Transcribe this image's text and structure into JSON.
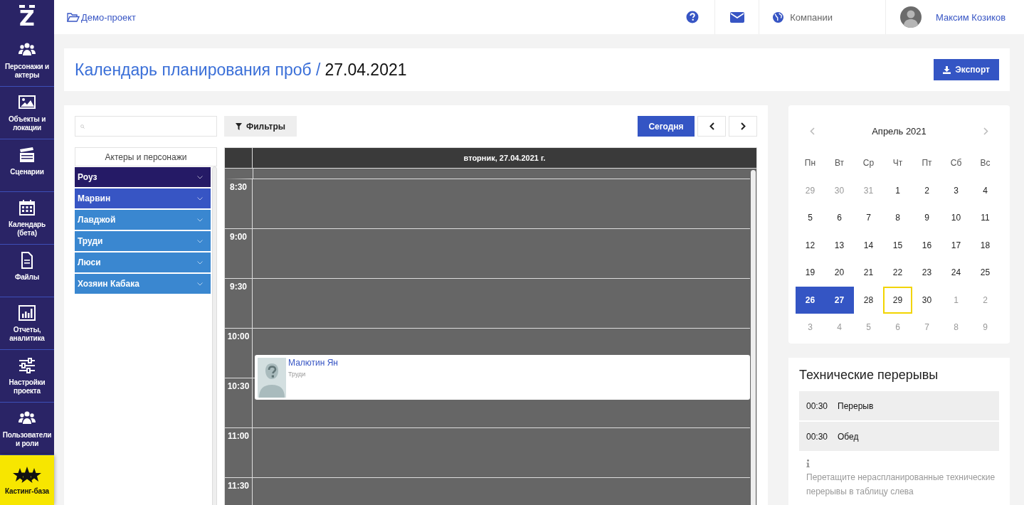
{
  "sidebar": {
    "logo": "Z",
    "items": [
      {
        "label": "Персонажи и актеры",
        "kind": "nav"
      },
      {
        "label": "Объекты и локации",
        "kind": "nav"
      },
      {
        "label": "Сценарии",
        "kind": "nav"
      },
      {
        "label": "Календарь (бета)",
        "kind": "nav"
      },
      {
        "label": "Файлы",
        "kind": "nav"
      },
      {
        "label": "Отчеты, аналитика",
        "kind": "nav"
      },
      {
        "label": "Настройки проекта",
        "kind": "nav"
      },
      {
        "label": "Пользователи и роли",
        "kind": "nav"
      },
      {
        "label": "Кастинг-база",
        "kind": "highlight"
      }
    ]
  },
  "topbar": {
    "project": "Демо-проект",
    "companies": "Компании",
    "user": "Максим Козиков"
  },
  "header": {
    "title": "Календарь планирования проб /",
    "date": "27.04.2021",
    "export_button": "Экспорт"
  },
  "toolbar": {
    "filters_button": "Фильтры",
    "today_button": "Сегодня"
  },
  "characters": {
    "title": "Актеры и персонажи",
    "items": [
      {
        "name": "Роуз",
        "color": "#251a66"
      },
      {
        "name": "Марвин",
        "color": "#3755c4"
      },
      {
        "name": "Лавджой",
        "color": "#3a87d0"
      },
      {
        "name": "Труди",
        "color": "#3a87d0"
      },
      {
        "name": "Люси",
        "color": "#3a87d0"
      },
      {
        "name": "Хозяин Кабака",
        "color": "#3a87d0"
      }
    ]
  },
  "schedule": {
    "day": "вторник, 27.04.2021 г.",
    "slots": [
      "8:30",
      "9:00",
      "9:30",
      "10:00",
      "10:30",
      "11:00",
      "11:30"
    ],
    "events": [
      {
        "name": "Малютин Ян",
        "role": "Труди"
      }
    ]
  },
  "mini_calendar": {
    "month": "Апрель 2021",
    "weekdays": [
      "Пн",
      "Вт",
      "Ср",
      "Чт",
      "Пт",
      "Сб",
      "Вс"
    ],
    "weeks": [
      [
        {
          "day": "29",
          "outside": true,
          "selected": false,
          "today": false
        },
        {
          "day": "30",
          "outside": true,
          "selected": false,
          "today": false
        },
        {
          "day": "31",
          "outside": true,
          "selected": false,
          "today": false
        },
        {
          "day": "1",
          "outside": false,
          "selected": false,
          "today": false
        },
        {
          "day": "2",
          "outside": false,
          "selected": false,
          "today": false
        },
        {
          "day": "3",
          "outside": false,
          "selected": false,
          "today": false
        },
        {
          "day": "4",
          "outside": false,
          "selected": false,
          "today": false
        }
      ],
      [
        {
          "day": "5",
          "outside": false,
          "selected": false,
          "today": false
        },
        {
          "day": "6",
          "outside": false,
          "selected": false,
          "today": false
        },
        {
          "day": "7",
          "outside": false,
          "selected": false,
          "today": false
        },
        {
          "day": "8",
          "outside": false,
          "selected": false,
          "today": false
        },
        {
          "day": "9",
          "outside": false,
          "selected": false,
          "today": false
        },
        {
          "day": "10",
          "outside": false,
          "selected": false,
          "today": false
        },
        {
          "day": "11",
          "outside": false,
          "selected": false,
          "today": false
        }
      ],
      [
        {
          "day": "12",
          "outside": false,
          "selected": false,
          "today": false
        },
        {
          "day": "13",
          "outside": false,
          "selected": false,
          "today": false
        },
        {
          "day": "14",
          "outside": false,
          "selected": false,
          "today": false
        },
        {
          "day": "15",
          "outside": false,
          "selected": false,
          "today": false
        },
        {
          "day": "16",
          "outside": false,
          "selected": false,
          "today": false
        },
        {
          "day": "17",
          "outside": false,
          "selected": false,
          "today": false
        },
        {
          "day": "18",
          "outside": false,
          "selected": false,
          "today": false
        }
      ],
      [
        {
          "day": "19",
          "outside": false,
          "selected": false,
          "today": false
        },
        {
          "day": "20",
          "outside": false,
          "selected": false,
          "today": false
        },
        {
          "day": "21",
          "outside": false,
          "selected": false,
          "today": false
        },
        {
          "day": "22",
          "outside": false,
          "selected": false,
          "today": false
        },
        {
          "day": "23",
          "outside": false,
          "selected": false,
          "today": false
        },
        {
          "day": "24",
          "outside": false,
          "selected": false,
          "today": false
        },
        {
          "day": "25",
          "outside": false,
          "selected": false,
          "today": false
        }
      ],
      [
        {
          "day": "26",
          "outside": false,
          "selected": true,
          "today": false
        },
        {
          "day": "27",
          "outside": false,
          "selected": true,
          "today": false
        },
        {
          "day": "28",
          "outside": false,
          "selected": false,
          "today": false
        },
        {
          "day": "29",
          "outside": false,
          "selected": false,
          "today": true
        },
        {
          "day": "30",
          "outside": false,
          "selected": false,
          "today": false
        },
        {
          "day": "1",
          "outside": true,
          "selected": false,
          "today": false
        },
        {
          "day": "2",
          "outside": true,
          "selected": false,
          "today": false
        }
      ],
      [
        {
          "day": "3",
          "outside": true,
          "selected": false,
          "today": false
        },
        {
          "day": "4",
          "outside": true,
          "selected": false,
          "today": false
        },
        {
          "day": "5",
          "outside": true,
          "selected": false,
          "today": false
        },
        {
          "day": "6",
          "outside": true,
          "selected": false,
          "today": false
        },
        {
          "day": "7",
          "outside": true,
          "selected": false,
          "today": false
        },
        {
          "day": "8",
          "outside": true,
          "selected": false,
          "today": false
        },
        {
          "day": "9",
          "outside": true,
          "selected": false,
          "today": false
        }
      ]
    ]
  },
  "breaks": {
    "title": "Технические перерывы",
    "items": [
      {
        "duration": "00:30",
        "name": "Перерыв"
      },
      {
        "duration": "00:30",
        "name": "Обед"
      }
    ],
    "hint": "Перетащите нераспланированные технические перерывы в таблицу слева"
  }
}
